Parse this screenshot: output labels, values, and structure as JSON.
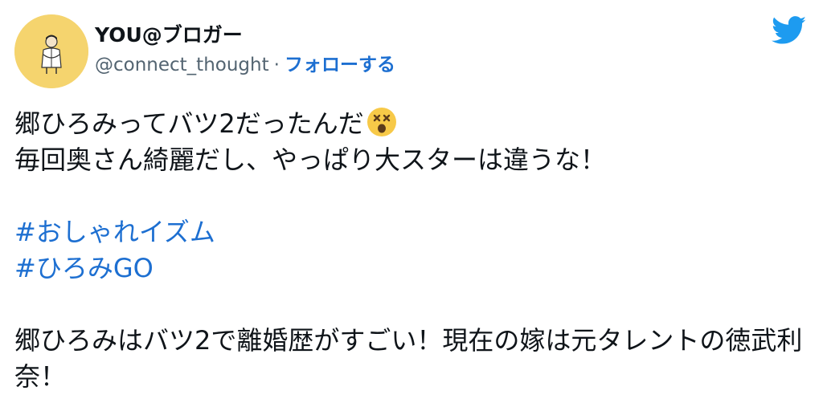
{
  "user": {
    "display_name": "YOU@ブロガー",
    "handle": "@connect_thought",
    "separator": "·",
    "follow_label": "フォローする"
  },
  "tweet": {
    "line1": "郷ひろみってバツ2だったんだ",
    "line1_emoji": "dizzy-face-emoji",
    "line2": "毎回奥さん綺麗だし、やっぱり大スターは違うな！",
    "hashtags": [
      "#おしゃれイズム",
      "#ひろみGO"
    ],
    "line3": "郷ひろみはバツ2で離婚歴がすごい！現在の嫁は元タレントの徳武利奈！"
  },
  "colors": {
    "link": "#1d6fd1",
    "twitter_blue": "#1d9bf0",
    "avatar_bg": "#f5d46e",
    "handle_gray": "#536471",
    "emoji_yellow": "#f7c948"
  },
  "icons": {
    "brand": "twitter-bird-icon",
    "avatar": "profile-avatar-illustration"
  }
}
